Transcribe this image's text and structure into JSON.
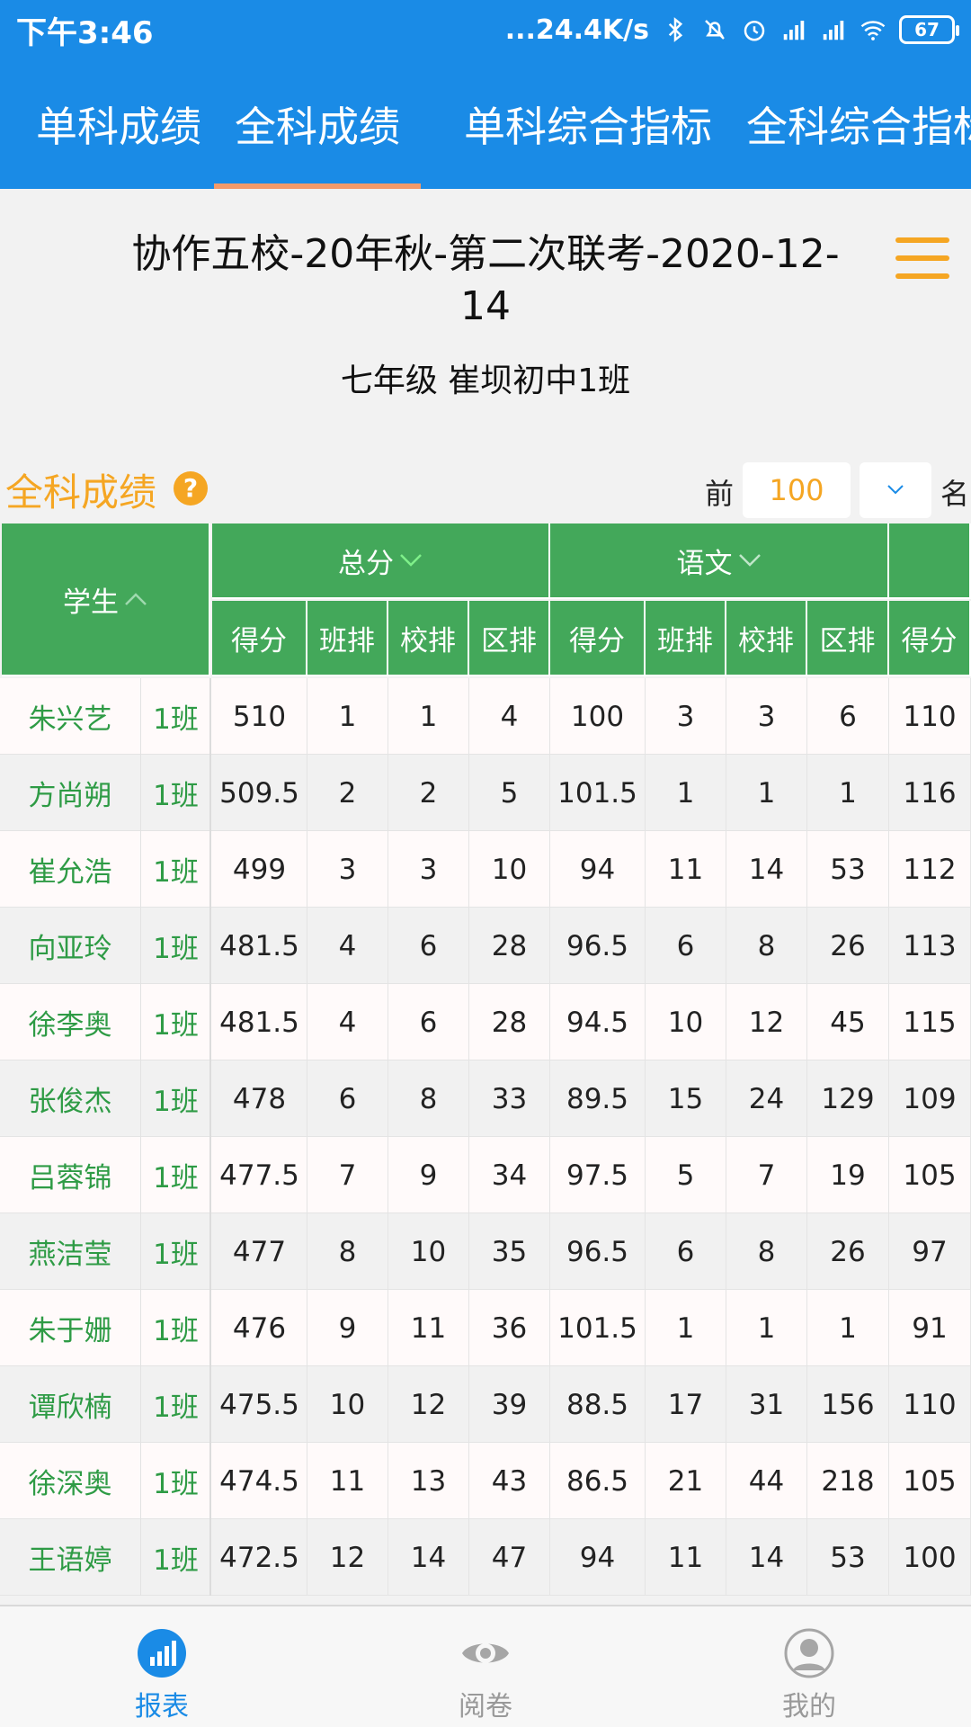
{
  "status_bar": {
    "time": "下午3:46",
    "net_speed": "...24.4K/s",
    "battery": "67"
  },
  "tabs": [
    "单科成绩",
    "全科成绩",
    "单科综合指标",
    "全科综合指标"
  ],
  "active_tab": 1,
  "header": {
    "title": "协作五校-20年秋-第二次联考-2020-12-14",
    "subtitle": "七年级 崔坝初中1班"
  },
  "section": {
    "title": "全科成绩",
    "help": "?",
    "top_label": "前",
    "top_value": "100",
    "suffix": "名"
  },
  "table": {
    "student_header": "学生",
    "groups": [
      "总分",
      "语文"
    ],
    "sub_headers": [
      "得分",
      "班排",
      "校排",
      "区排",
      "得分",
      "班排",
      "校排",
      "区排",
      "得分"
    ],
    "rows": [
      {
        "name": "朱兴艺",
        "class": "1班",
        "v": [
          "510",
          "1",
          "1",
          "4",
          "100",
          "3",
          "3",
          "6",
          "110"
        ]
      },
      {
        "name": "方尚朔",
        "class": "1班",
        "v": [
          "509.5",
          "2",
          "2",
          "5",
          "101.5",
          "1",
          "1",
          "1",
          "116"
        ]
      },
      {
        "name": "崔允浩",
        "class": "1班",
        "v": [
          "499",
          "3",
          "3",
          "10",
          "94",
          "11",
          "14",
          "53",
          "112"
        ]
      },
      {
        "name": "向亚玲",
        "class": "1班",
        "v": [
          "481.5",
          "4",
          "6",
          "28",
          "96.5",
          "6",
          "8",
          "26",
          "113"
        ]
      },
      {
        "name": "徐李奥",
        "class": "1班",
        "v": [
          "481.5",
          "4",
          "6",
          "28",
          "94.5",
          "10",
          "12",
          "45",
          "115"
        ]
      },
      {
        "name": "张俊杰",
        "class": "1班",
        "v": [
          "478",
          "6",
          "8",
          "33",
          "89.5",
          "15",
          "24",
          "129",
          "109"
        ]
      },
      {
        "name": "吕蓉锦",
        "class": "1班",
        "v": [
          "477.5",
          "7",
          "9",
          "34",
          "97.5",
          "5",
          "7",
          "19",
          "105"
        ]
      },
      {
        "name": "燕洁莹",
        "class": "1班",
        "v": [
          "477",
          "8",
          "10",
          "35",
          "96.5",
          "6",
          "8",
          "26",
          "97"
        ]
      },
      {
        "name": "朱于姗",
        "class": "1班",
        "v": [
          "476",
          "9",
          "11",
          "36",
          "101.5",
          "1",
          "1",
          "1",
          "91"
        ]
      },
      {
        "name": "谭欣楠",
        "class": "1班",
        "v": [
          "475.5",
          "10",
          "12",
          "39",
          "88.5",
          "17",
          "31",
          "156",
          "110"
        ]
      },
      {
        "name": "徐深奥",
        "class": "1班",
        "v": [
          "474.5",
          "11",
          "13",
          "43",
          "86.5",
          "21",
          "44",
          "218",
          "105"
        ]
      },
      {
        "name": "王语婷",
        "class": "1班",
        "v": [
          "472.5",
          "12",
          "14",
          "47",
          "94",
          "11",
          "14",
          "53",
          "100"
        ]
      }
    ]
  },
  "bottom_nav": [
    "报表",
    "阅卷",
    "我的"
  ],
  "colors": {
    "primary": "#1a8be6",
    "accent": "#f5a623",
    "table_header": "#43a85a",
    "name_green": "#2e9b45",
    "tab_indicator": "#f39a6a"
  }
}
